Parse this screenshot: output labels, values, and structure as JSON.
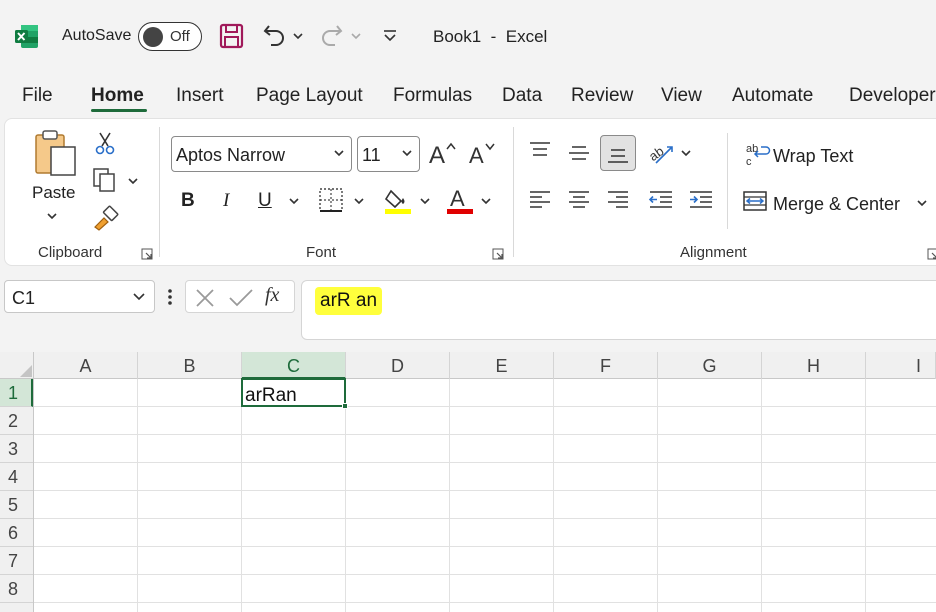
{
  "titlebar": {
    "autosave_label": "AutoSave",
    "autosave_state": "Off",
    "doc_title": "Book1  -  Excel"
  },
  "tabs": [
    "File",
    "Home",
    "Insert",
    "Page Layout",
    "Formulas",
    "Data",
    "Review",
    "View",
    "Automate",
    "Developer"
  ],
  "active_tab": "Home",
  "ribbon": {
    "clipboard": {
      "paste_label": "Paste",
      "group_label": "Clipboard"
    },
    "font": {
      "font_name": "Aptos Narrow",
      "font_size": "11",
      "bold": "B",
      "italic": "I",
      "underline": "U",
      "group_label": "Font"
    },
    "alignment": {
      "wrap_text": "Wrap Text",
      "merge_center": "Merge & Center",
      "group_label": "Alignment"
    }
  },
  "formula_bar": {
    "name_box": "C1",
    "fx_label": "fx",
    "formula": "arR an"
  },
  "grid": {
    "columns": [
      "A",
      "B",
      "C",
      "D",
      "E",
      "F",
      "G",
      "H",
      "I"
    ],
    "rows": [
      "1",
      "2",
      "3",
      "4",
      "5",
      "6",
      "7",
      "8"
    ],
    "selected_column": "C",
    "selected_row": "1",
    "cells": {
      "C1": "arRan"
    }
  },
  "colors": {
    "accent": "#1e6b3b",
    "highlight": "#ffff3c",
    "font_color": "#e00000",
    "fill_color": "#ffff00"
  }
}
